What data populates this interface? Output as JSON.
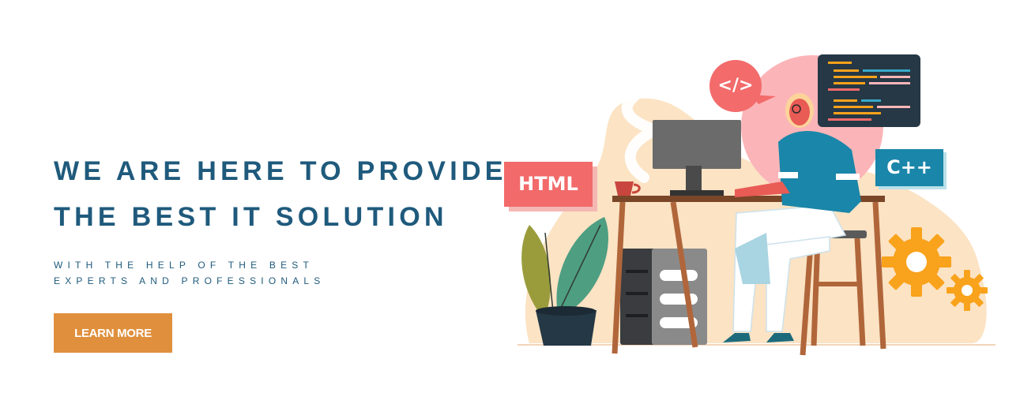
{
  "hero": {
    "headline_line1": "WE ARE HERE TO PROVIDE",
    "headline_line2": "THE BEST IT SOLUTION",
    "subline_line1": "WITH THE HELP OF THE BEST",
    "subline_line2": "EXPERTS AND PROFESSIONALS",
    "cta_label": "LEARN MORE"
  },
  "illustration": {
    "html_tag": "HTML",
    "cpp_tag": "C++",
    "code_bubble": "</>"
  },
  "colors": {
    "headline": "#1f5a7c",
    "cta_background": "#e0903d",
    "html_tag": "#f26a6a",
    "cpp_tag": "#1a86a9",
    "code_bubble": "#f36b6b",
    "blob_peach": "#fbe3c4",
    "blob_pink": "#fbb5b8",
    "gear": "#f9a21b"
  },
  "icons": [
    "code-bubble-icon",
    "code-window-icon",
    "gear-icon",
    "plant-icon",
    "coffee-cup-icon",
    "monitor-icon",
    "computer-tower-icon"
  ]
}
